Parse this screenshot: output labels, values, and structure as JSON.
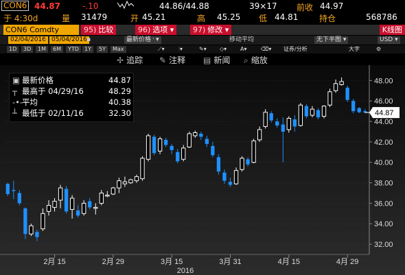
{
  "quote": {
    "ticker": "CON6",
    "last": "44.87",
    "change": "-.10",
    "bid_ask": "44.86/44.88",
    "size": "39×17",
    "prev_close_label": "前收",
    "prev_close": "44.97",
    "time": "于 4:30d",
    "volume_label": "量",
    "volume": "31479",
    "open_label": "开",
    "open": "45.21",
    "high_label": "高",
    "high": "45.25",
    "low_label": "低",
    "low": "44.81",
    "oi_label": "持仓",
    "oi": "568786"
  },
  "command": {
    "security": "CON6 Comdty",
    "compare_num": "95)",
    "compare": "比较",
    "options_num": "96)",
    "options": "选项",
    "edit_num": "97)",
    "edit": "修改",
    "kline": "K线图"
  },
  "dates": {
    "start": "02/04/2016",
    "end": "05/04/2016",
    "last_price_btn": "最新价格",
    "ma_label": "移动平均",
    "no_lower": "无下半图",
    "currency": "USD"
  },
  "periods": [
    "1D",
    "3D",
    "1M",
    "6M",
    "YTD",
    "1Y",
    "5Y",
    "Max"
  ],
  "period_right": {
    "indicators": "证券/分析",
    "bigger": "大字"
  },
  "toolbar": {
    "track": "追踪",
    "annotate": "注释",
    "news": "新闻",
    "zoom": "缩放"
  },
  "legend": {
    "last_label": "最新价格",
    "last_value": "44.87",
    "high_label": "最高于 04/29/16",
    "high_value": "48.29",
    "avg_label": "平均",
    "avg_value": "40.38",
    "low_label": "最低于 02/11/16",
    "low_value": "32.30"
  },
  "colors": {
    "up": "#ffffff",
    "down": "#1e90ff",
    "accent": "#f0a500",
    "button_red": "#c8102e",
    "price_label_bg": "#ffffff"
  },
  "chart_data": {
    "type": "candlestick",
    "title": "",
    "xlabel": "2016",
    "ylabel": "",
    "ylim": [
      31.0,
      49.5
    ],
    "y_ticks": [
      32.0,
      34.0,
      36.0,
      38.0,
      40.0,
      42.0,
      44.0,
      46.0,
      48.0
    ],
    "y_tick_labels": [
      "32.00",
      "34.00",
      "36.00",
      "38.00",
      "40.00",
      "42.00",
      "44.00",
      "46.00",
      "48.00"
    ],
    "x_ticks": [
      {
        "index": 8,
        "label": "2月 15"
      },
      {
        "index": 18,
        "label": "2月 29"
      },
      {
        "index": 28,
        "label": "3月 15"
      },
      {
        "index": 38,
        "label": "3月 31"
      },
      {
        "index": 48,
        "label": "4月 15"
      },
      {
        "index": 58,
        "label": "4月 29"
      }
    ],
    "last_price_label": "44.87",
    "candles": [
      {
        "o": 37.9,
        "h": 38.0,
        "l": 36.7,
        "c": 36.9
      },
      {
        "o": 37.3,
        "h": 38.2,
        "l": 36.4,
        "c": 37.2
      },
      {
        "o": 37.0,
        "h": 37.3,
        "l": 35.8,
        "c": 36.0
      },
      {
        "o": 35.5,
        "h": 35.6,
        "l": 32.5,
        "c": 33.0
      },
      {
        "o": 33.0,
        "h": 34.0,
        "l": 32.8,
        "c": 33.8
      },
      {
        "o": 33.2,
        "h": 33.4,
        "l": 32.3,
        "c": 32.7
      },
      {
        "o": 33.5,
        "h": 35.5,
        "l": 33.3,
        "c": 35.0
      },
      {
        "o": 35.2,
        "h": 36.3,
        "l": 34.8,
        "c": 35.8
      },
      {
        "o": 35.6,
        "h": 36.5,
        "l": 35.2,
        "c": 36.2
      },
      {
        "o": 36.3,
        "h": 37.8,
        "l": 35.5,
        "c": 37.5
      },
      {
        "o": 37.4,
        "h": 37.7,
        "l": 35.0,
        "c": 35.2
      },
      {
        "o": 35.4,
        "h": 36.8,
        "l": 34.5,
        "c": 36.5
      },
      {
        "o": 35.3,
        "h": 35.8,
        "l": 34.6,
        "c": 34.8
      },
      {
        "o": 35.0,
        "h": 36.3,
        "l": 34.8,
        "c": 36.0
      },
      {
        "o": 36.2,
        "h": 36.5,
        "l": 35.4,
        "c": 35.6
      },
      {
        "o": 35.5,
        "h": 36.0,
        "l": 34.9,
        "c": 35.6
      },
      {
        "o": 36.0,
        "h": 37.3,
        "l": 35.8,
        "c": 37.0
      },
      {
        "o": 36.7,
        "h": 37.2,
        "l": 36.6,
        "c": 36.8
      },
      {
        "o": 36.9,
        "h": 37.6,
        "l": 36.8,
        "c": 37.5
      },
      {
        "o": 37.5,
        "h": 38.5,
        "l": 37.0,
        "c": 38.2
      },
      {
        "o": 37.9,
        "h": 38.6,
        "l": 37.6,
        "c": 38.1
      },
      {
        "o": 38.0,
        "h": 38.4,
        "l": 37.9,
        "c": 38.3
      },
      {
        "o": 38.2,
        "h": 38.8,
        "l": 38.0,
        "c": 38.6
      },
      {
        "o": 38.4,
        "h": 40.6,
        "l": 38.2,
        "c": 40.4
      },
      {
        "o": 40.3,
        "h": 42.8,
        "l": 40.1,
        "c": 42.6
      },
      {
        "o": 42.5,
        "h": 42.7,
        "l": 40.7,
        "c": 40.9
      },
      {
        "o": 41.1,
        "h": 42.5,
        "l": 40.8,
        "c": 42.3
      },
      {
        "o": 42.2,
        "h": 42.4,
        "l": 41.5,
        "c": 41.7
      },
      {
        "o": 41.6,
        "h": 41.8,
        "l": 40.8,
        "c": 41.2
      },
      {
        "o": 41.0,
        "h": 41.3,
        "l": 39.9,
        "c": 40.1
      },
      {
        "o": 40.3,
        "h": 41.7,
        "l": 40.1,
        "c": 41.4
      },
      {
        "o": 41.5,
        "h": 43.0,
        "l": 41.4,
        "c": 42.8
      },
      {
        "o": 42.6,
        "h": 43.1,
        "l": 42.4,
        "c": 42.9
      },
      {
        "o": 42.8,
        "h": 43.0,
        "l": 42.2,
        "c": 42.5
      },
      {
        "o": 42.3,
        "h": 42.6,
        "l": 41.5,
        "c": 41.8
      },
      {
        "o": 41.6,
        "h": 42.0,
        "l": 40.5,
        "c": 40.7
      },
      {
        "o": 40.5,
        "h": 40.8,
        "l": 38.8,
        "c": 39.1
      },
      {
        "o": 39.0,
        "h": 39.3,
        "l": 37.9,
        "c": 38.2
      },
      {
        "o": 38.1,
        "h": 38.5,
        "l": 37.6,
        "c": 37.8
      },
      {
        "o": 37.9,
        "h": 39.5,
        "l": 37.8,
        "c": 39.2
      },
      {
        "o": 39.3,
        "h": 40.6,
        "l": 39.1,
        "c": 40.4
      },
      {
        "o": 40.3,
        "h": 40.5,
        "l": 39.6,
        "c": 39.8
      },
      {
        "o": 40.0,
        "h": 42.3,
        "l": 39.9,
        "c": 42.1
      },
      {
        "o": 42.2,
        "h": 43.5,
        "l": 42.0,
        "c": 43.2
      },
      {
        "o": 43.5,
        "h": 45.2,
        "l": 43.3,
        "c": 44.9
      },
      {
        "o": 44.8,
        "h": 45.0,
        "l": 43.9,
        "c": 44.1
      },
      {
        "o": 44.0,
        "h": 44.3,
        "l": 43.4,
        "c": 43.6
      },
      {
        "o": 43.7,
        "h": 44.4,
        "l": 40.0,
        "c": 43.0
      },
      {
        "o": 43.2,
        "h": 44.5,
        "l": 42.9,
        "c": 44.3
      },
      {
        "o": 44.2,
        "h": 44.6,
        "l": 43.0,
        "c": 43.5
      },
      {
        "o": 43.6,
        "h": 45.8,
        "l": 43.5,
        "c": 45.6
      },
      {
        "o": 45.5,
        "h": 45.7,
        "l": 44.3,
        "c": 44.5
      },
      {
        "o": 44.6,
        "h": 45.5,
        "l": 44.4,
        "c": 45.2
      },
      {
        "o": 45.1,
        "h": 45.3,
        "l": 44.2,
        "c": 44.4
      },
      {
        "o": 44.5,
        "h": 45.6,
        "l": 44.3,
        "c": 45.5
      },
      {
        "o": 45.6,
        "h": 47.2,
        "l": 45.4,
        "c": 46.9
      },
      {
        "o": 47.0,
        "h": 48.1,
        "l": 46.8,
        "c": 47.7
      },
      {
        "o": 47.6,
        "h": 48.3,
        "l": 47.5,
        "c": 47.9
      },
      {
        "o": 47.3,
        "h": 47.5,
        "l": 45.9,
        "c": 46.1
      },
      {
        "o": 46.0,
        "h": 46.2,
        "l": 44.8,
        "c": 45.0
      },
      {
        "o": 45.3,
        "h": 45.4,
        "l": 44.8,
        "c": 44.9
      },
      {
        "o": 45.0,
        "h": 45.2,
        "l": 44.8,
        "c": 44.87
      }
    ]
  }
}
